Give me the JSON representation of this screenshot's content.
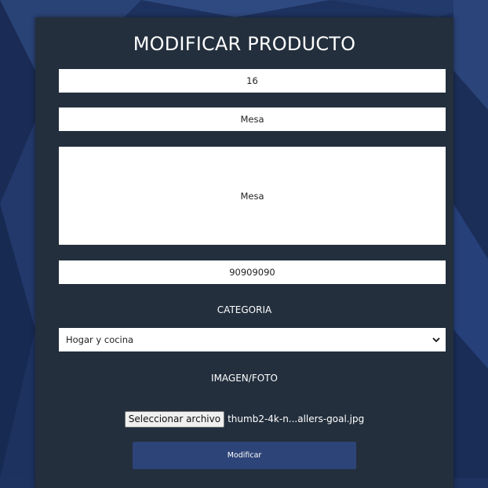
{
  "form": {
    "title": "MODIFICAR PRODUCTO",
    "id_value": "16",
    "name_value": "Mesa",
    "description_value": "Mesa",
    "price_value": "90909090",
    "category_label": "CATEGORIA",
    "category_selected": "Hogar y cocina",
    "image_label": "IMAGEN/FOTO",
    "file_button_label": "Seleccionar archivo",
    "file_name": "thumb2-4k-n...allers-goal.jpg",
    "submit_label": "Modificar"
  },
  "colors": {
    "background": "#1f3360",
    "card": "#232f3d",
    "submit": "#2d4478"
  }
}
